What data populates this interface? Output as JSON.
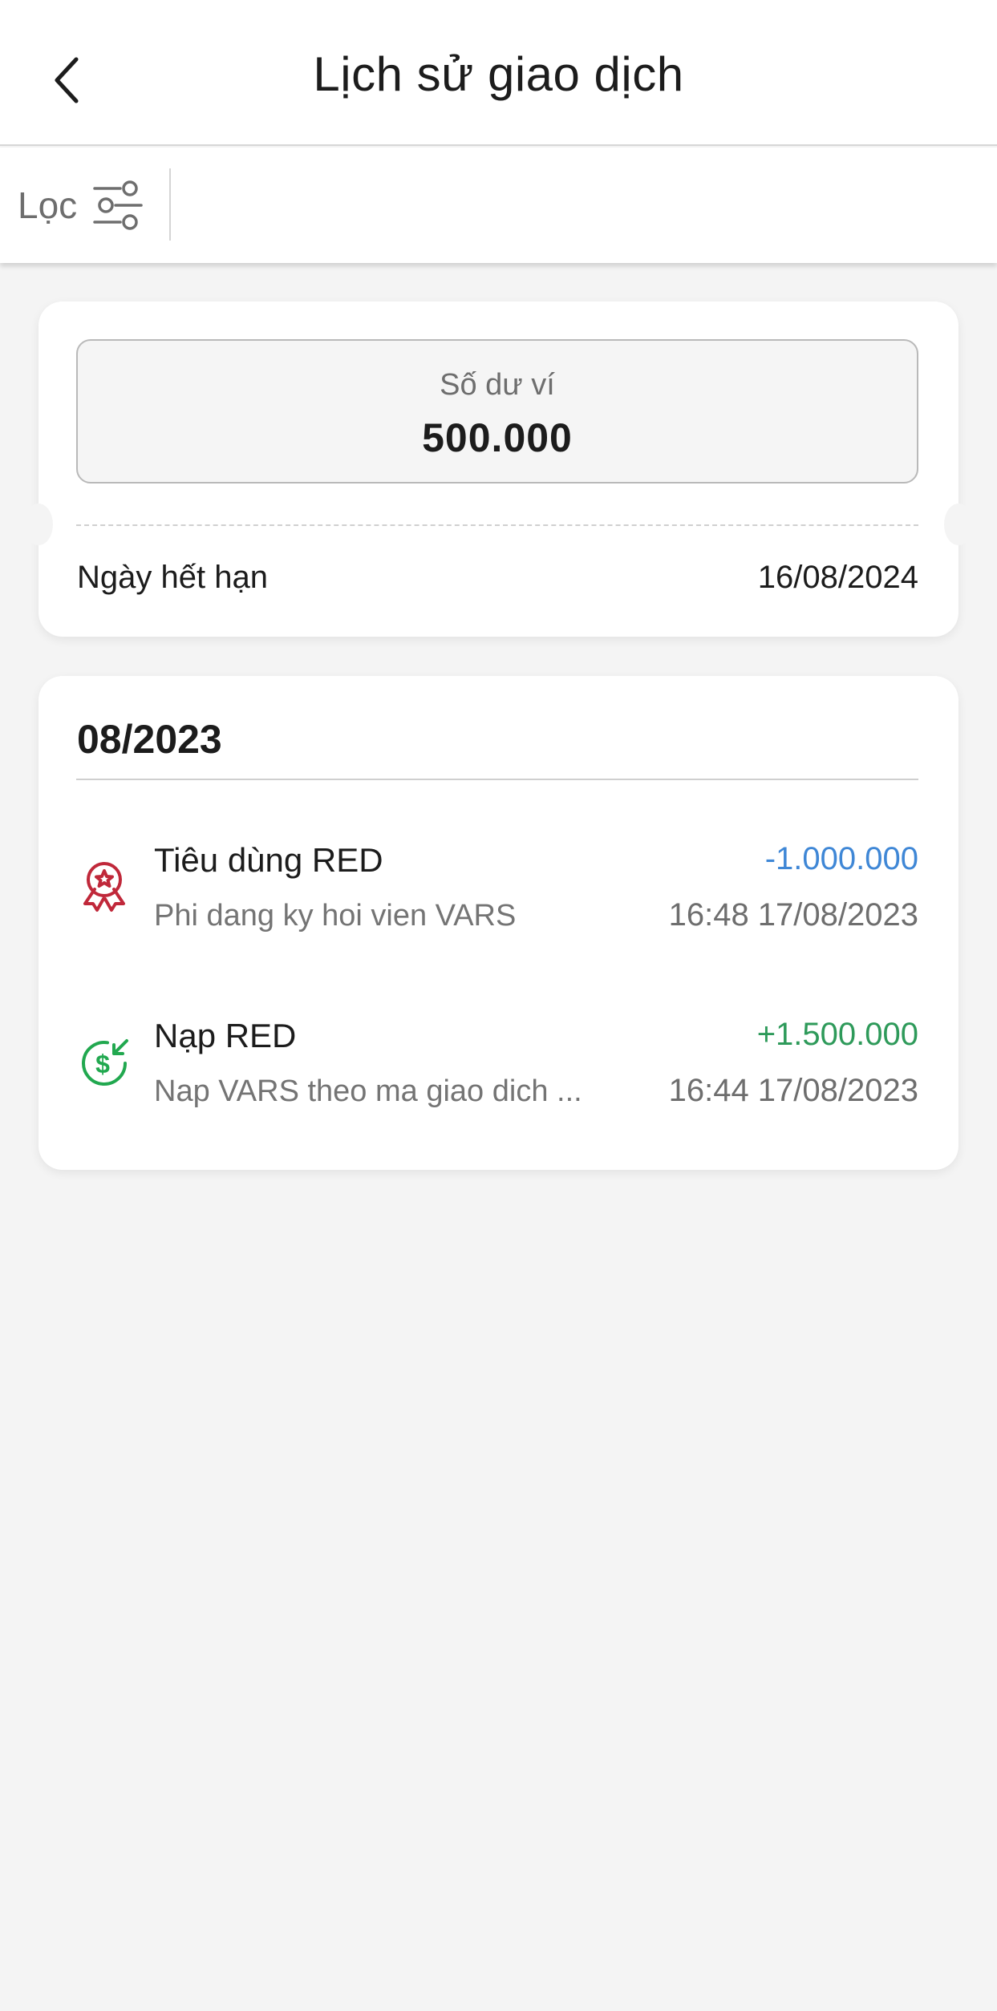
{
  "header": {
    "title": "Lịch sử giao dịch",
    "back_icon": "chevron-left-icon"
  },
  "filter": {
    "label": "Lọc",
    "icon": "sliders-icon"
  },
  "wallet": {
    "balance_label": "Số dư ví",
    "balance_value": "500.000",
    "expiry_label": "Ngày hết hạn",
    "expiry_value": "16/08/2024"
  },
  "history": {
    "month": "08/2023",
    "transactions": [
      {
        "title": "Tiêu dùng RED",
        "description": "Phi dang ky hoi vien VARS",
        "amount": "-1.000.000",
        "time": "16:48 17/08/2023",
        "icon": "award-ribbon-icon",
        "amount_color": "#3f87d6",
        "icon_color": "#c0283a"
      },
      {
        "title": "Nạp RED",
        "description": "Nap VARS theo ma giao dich ...",
        "amount": "+1.500.000",
        "time": "16:44 17/08/2023",
        "icon": "dollar-deposit-icon",
        "amount_color": "#2e9a5a",
        "icon_color": "#21a84f"
      }
    ]
  }
}
